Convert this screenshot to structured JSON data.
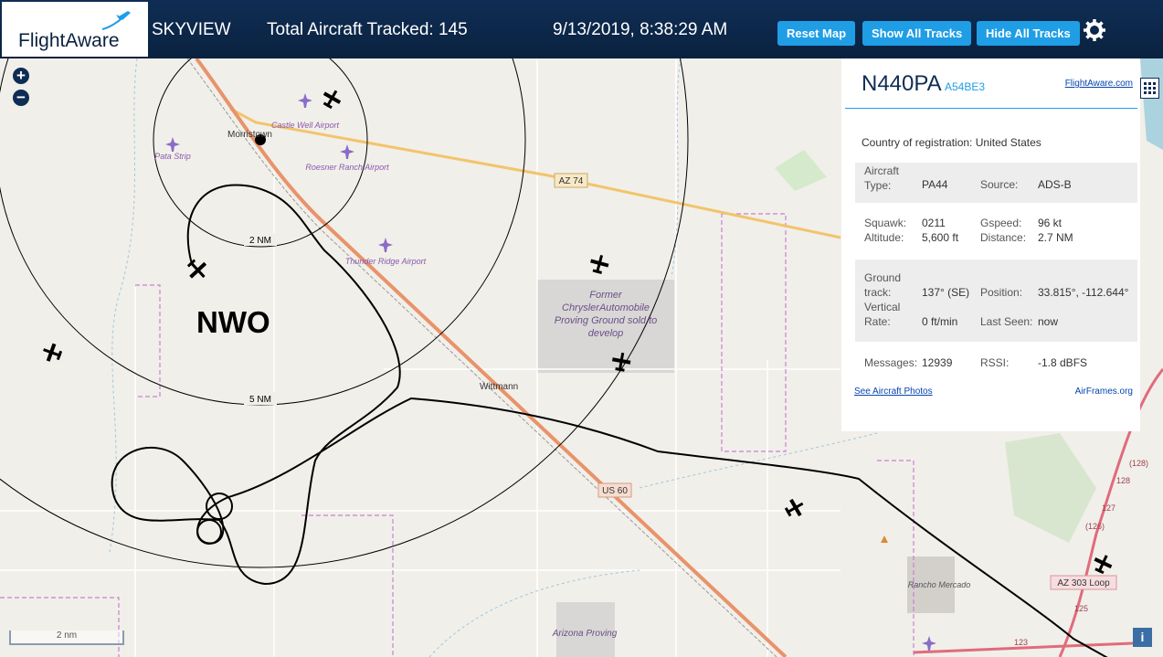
{
  "header": {
    "logo_text": "FlightAware",
    "app_name": "SKYVIEW",
    "total_tracked": "Total Aircraft Tracked: 145",
    "datetime": "9/13/2019, 8:38:29 AM",
    "reset_label": "Reset Map",
    "show_label": "Show All Tracks",
    "hide_label": "Hide All Tracks",
    "settings_icon": "gear-icon"
  },
  "map": {
    "zoom_in": "+",
    "zoom_out": "−",
    "range_rings": [
      "2 NM",
      "5 NM"
    ],
    "station_label": "NWO",
    "places": [
      "Morristown",
      "Wittmann",
      "Castle Well Airport",
      "Roesner Ranch Airport",
      "Thunder Ridge Airport",
      "Pata Strip",
      "Former ChryslerAutomobile Proving Ground sold to develop",
      "Rancho Mercado",
      "Arizona Proving"
    ],
    "roads": [
      "AZ 74",
      "US 60",
      "AZ 303 Loop",
      "(128)",
      "128",
      "127",
      "(126)",
      "125",
      "123"
    ],
    "scale_label": "2 nm",
    "colors": {
      "track": "#000000",
      "road": "#e8936b",
      "boundary": "#c77fd6"
    }
  },
  "panel": {
    "registration": "N440PA",
    "hex": "A54BE3",
    "fa_link": "FlightAware.com",
    "country_label": "Country of registration:",
    "country_value": "United States",
    "aircraft_type_label": "Aircraft Type:",
    "aircraft_type_value": "PA44",
    "source_label": "Source:",
    "source_value": "ADS-B",
    "squawk_label": "Squawk:",
    "squawk_value": "0211",
    "gspeed_label": "Gspeed:",
    "gspeed_value": "96 kt",
    "altitude_label": "Altitude:",
    "altitude_value": "5,600 ft",
    "distance_label": "Distance:",
    "distance_value": "2.7 NM",
    "track_label": "Ground track:",
    "track_value": "137° (SE)",
    "position_label": "Position:",
    "position_value": "33.815°, -112.644°",
    "vrate_label": "Vertical Rate:",
    "vrate_value": "0 ft/min",
    "lastseen_label": "Last Seen:",
    "lastseen_value": "now",
    "messages_label": "Messages:",
    "messages_value": "12939",
    "rssi_label": "RSSI:",
    "rssi_value": "-1.8 dBFS",
    "photos_link": "See Aircraft Photos",
    "airframes_link": "AirFrames.org"
  }
}
